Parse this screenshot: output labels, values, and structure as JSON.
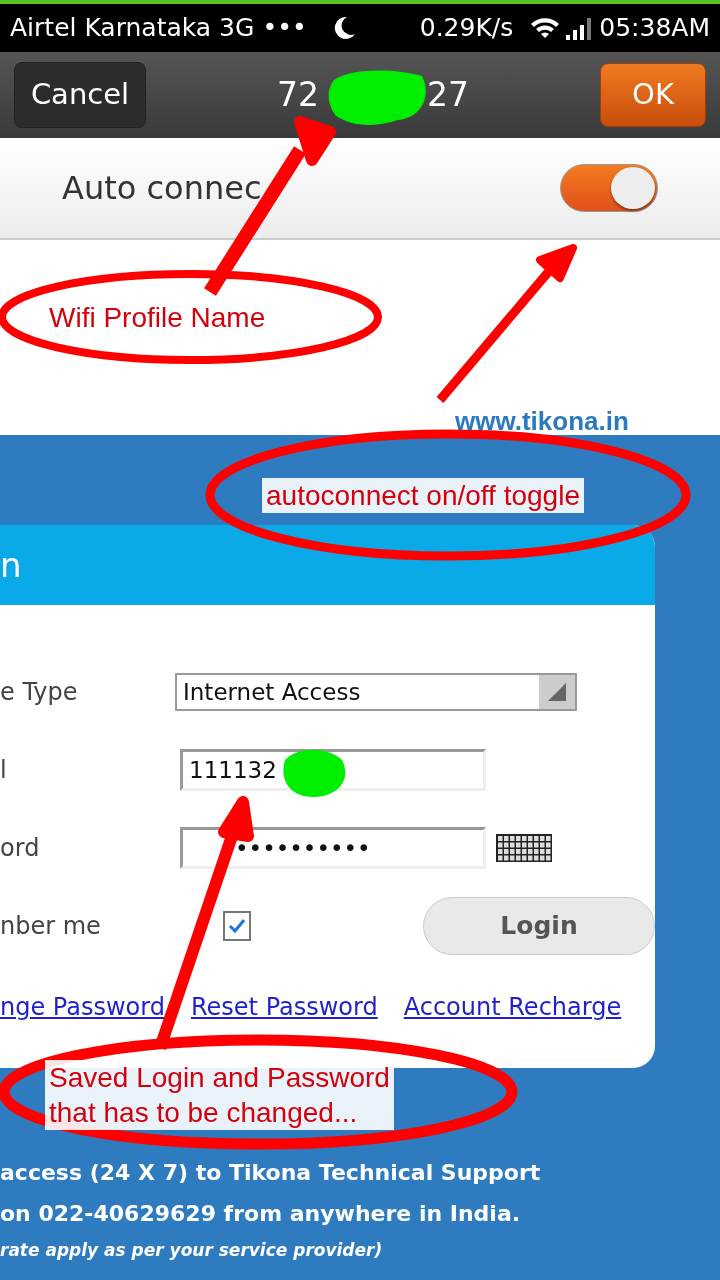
{
  "status_bar": {
    "carrier": "Airtel Karnataka 3G",
    "dots": "•••",
    "speed": "0.29K/s",
    "time": "05:38AM"
  },
  "header": {
    "cancel": "Cancel",
    "title_start": "72",
    "title_end": "27",
    "ok": "OK"
  },
  "auto_connect": {
    "label": "Auto connec",
    "on": true
  },
  "login_card": {
    "title": "n",
    "fields": [
      {
        "kind": "select",
        "label": "e Type",
        "value": "Internet Access"
      },
      {
        "kind": "text",
        "label": "l",
        "value": "111132"
      },
      {
        "kind": "password",
        "label": "ord",
        "value": "••••••••••"
      },
      {
        "kind": "checkbox",
        "label": "nber me",
        "checked": true
      }
    ],
    "login_button": "Login",
    "links": [
      "nge Password",
      "Reset Password",
      "Account Recharge"
    ]
  },
  "support": {
    "lines": [
      "access (24 X 7) to Tikona Technical Support",
      "on 022-40629629 from anywhere in India."
    ],
    "note": "rate apply as per your service provider)"
  },
  "watermark_text": "www.tikona.in",
  "annotations": [
    {
      "kind": "ellipse",
      "lines": [
        "Wifi Profile Name"
      ]
    },
    {
      "kind": "ellipse",
      "lines": [
        "autoconnect on/off toggle"
      ]
    },
    {
      "kind": "ellipse",
      "lines": [
        "Saved Login and Password",
        "that has to be changed..."
      ]
    }
  ]
}
